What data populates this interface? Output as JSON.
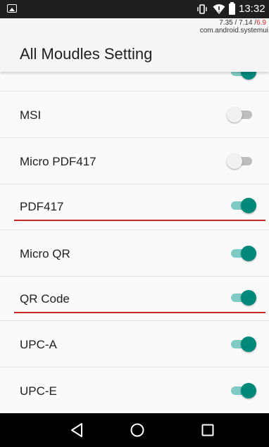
{
  "status_bar": {
    "time": "13:32",
    "icons": [
      "image-notification-icon",
      "vibrate-icon",
      "wifi-icon",
      "battery-icon"
    ]
  },
  "overlay": {
    "line1_a": "7.35 / 7.14 /",
    "line1_b": "6.9",
    "line2": "com.android.systemui"
  },
  "app_bar": {
    "title": "All Moudles Setting"
  },
  "settings": [
    {
      "label": "MSI",
      "enabled": false
    },
    {
      "label": "Micro PDF417",
      "enabled": false
    },
    {
      "label": "PDF417",
      "enabled": true
    },
    {
      "label": "Micro QR",
      "enabled": true
    },
    {
      "label": "QR Code",
      "enabled": true
    },
    {
      "label": "UPC-A",
      "enabled": true
    },
    {
      "label": "UPC-E",
      "enabled": true
    }
  ],
  "colors": {
    "toggle_on": "#00897b",
    "toggle_on_track": "#80cbc4",
    "toggle_off_track": "#bdbdbd",
    "highlight_underline": "#c62828"
  },
  "nav_bar": {
    "buttons": [
      "back-icon",
      "home-icon",
      "recents-icon"
    ]
  }
}
